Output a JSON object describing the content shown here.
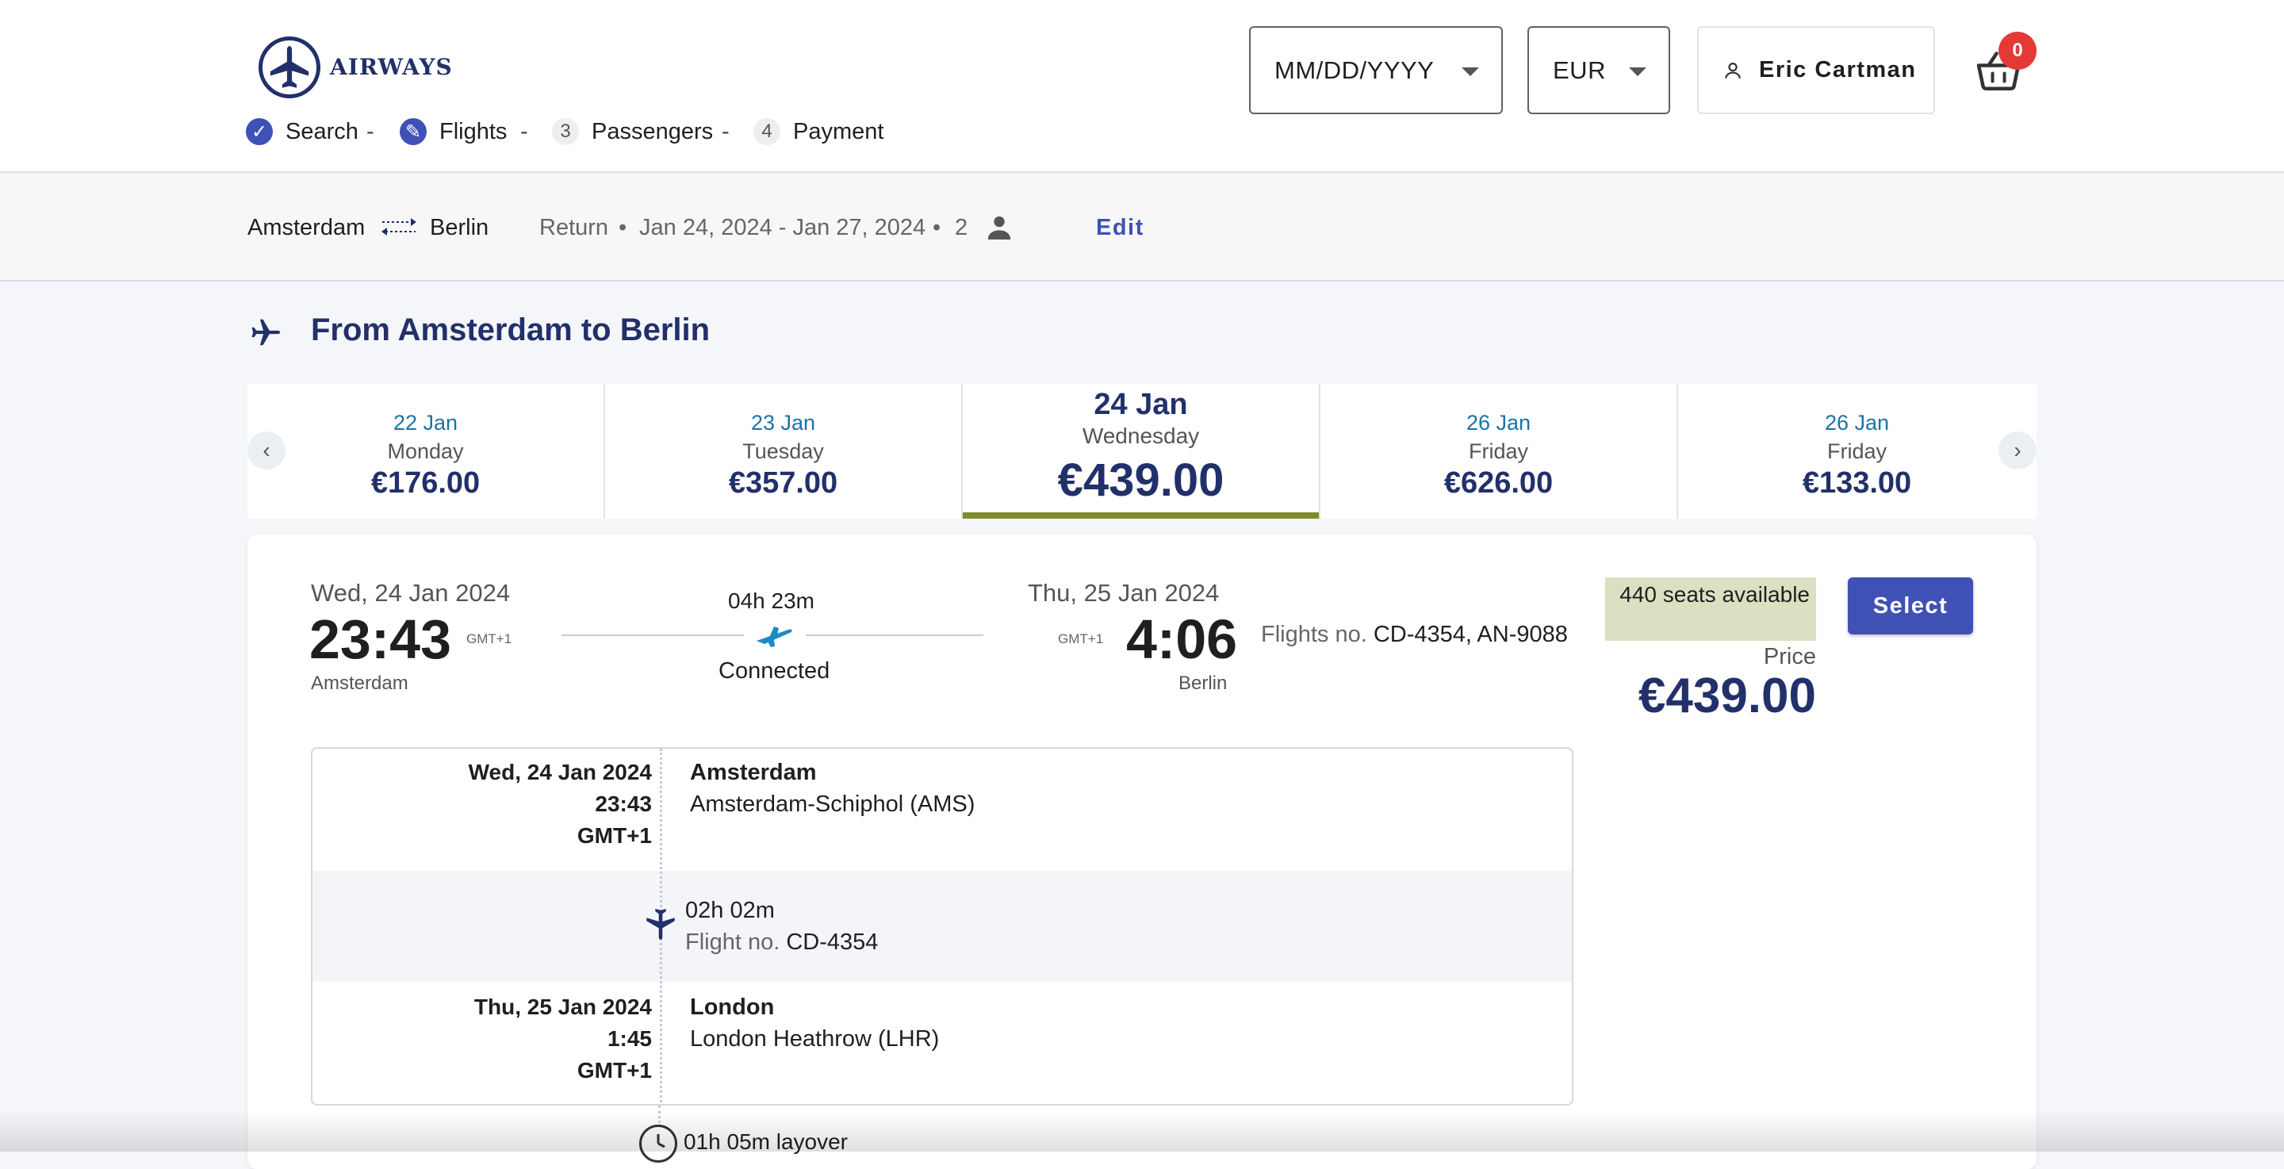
{
  "brand": {
    "name": "AIRWAYS",
    "logo_icon": "airplane-logo-icon"
  },
  "steps": [
    {
      "label": "Search",
      "badge": "✓",
      "state": "done"
    },
    {
      "label": "Flights",
      "badge": "✎",
      "state": "current"
    },
    {
      "label": "Passengers",
      "badge": "3",
      "state": "todo"
    },
    {
      "label": "Payment",
      "badge": "4",
      "state": "todo"
    }
  ],
  "step_separator": "-",
  "header": {
    "date_select": "MM/DD/YYYY",
    "currency_select": "EUR",
    "user_name": "Eric Cartman",
    "cart_count": "0"
  },
  "summary": {
    "origin": "Amsterdam",
    "destination": "Berlin",
    "trip_type": "Return",
    "dates": "Jan 24, 2024 - Jan 27, 2024",
    "passengers": "2",
    "edit_label": "Edit",
    "bullet": "•"
  },
  "section_title": "From Amsterdam to Berlin",
  "date_tabs": [
    {
      "date": "22 Jan",
      "weekday": "Monday",
      "price": "€176.00"
    },
    {
      "date": "23 Jan",
      "weekday": "Tuesday",
      "price": "€357.00"
    },
    {
      "date": "24 Jan",
      "weekday": "Wednesday",
      "price": "€439.00",
      "active": true
    },
    {
      "date": "26 Jan",
      "weekday": "Friday",
      "price": "€626.00"
    },
    {
      "date": "26 Jan",
      "weekday": "Friday",
      "price": "€133.00"
    }
  ],
  "nav": {
    "prev": "‹",
    "next": "›"
  },
  "flight": {
    "departure": {
      "date": "Wed, 24 Jan 2024",
      "time": "23:43",
      "tz": "GMT+1",
      "city": "Amsterdam"
    },
    "arrival": {
      "date": "Thu, 25 Jan 2024",
      "time": "4:06",
      "tz": "GMT+1",
      "city": "Berlin"
    },
    "duration": "04h 23m",
    "connection": "Connected",
    "flights_label": "Flights no.",
    "flights_numbers": "CD-4354, AN-9088",
    "seats": "440 seats available",
    "price_label": "Price",
    "price": "€439.00",
    "select_label": "Select"
  },
  "itinerary": {
    "segment1_dep": {
      "date": "Wed, 24 Jan 2024",
      "time": "23:43",
      "tz": "GMT+1",
      "city": "Amsterdam",
      "airport": "Amsterdam-Schiphol (AMS)"
    },
    "leg": {
      "duration": "02h 02m",
      "flight_label": "Flight no.",
      "flight_no": "CD-4354"
    },
    "segment1_arr": {
      "date": "Thu, 25 Jan 2024",
      "time": "1:45",
      "tz": "GMT+1",
      "city": "London",
      "airport": "London Heathrow (LHR)"
    },
    "layover": "01h 05m layover"
  },
  "colors": {
    "brand_navy": "#22306a",
    "primary": "#3f51b5",
    "link_blue": "#1a73a8",
    "active_underline": "#7f8c2b",
    "seats_bg": "#dce0c2",
    "badge_red": "#e53935"
  }
}
